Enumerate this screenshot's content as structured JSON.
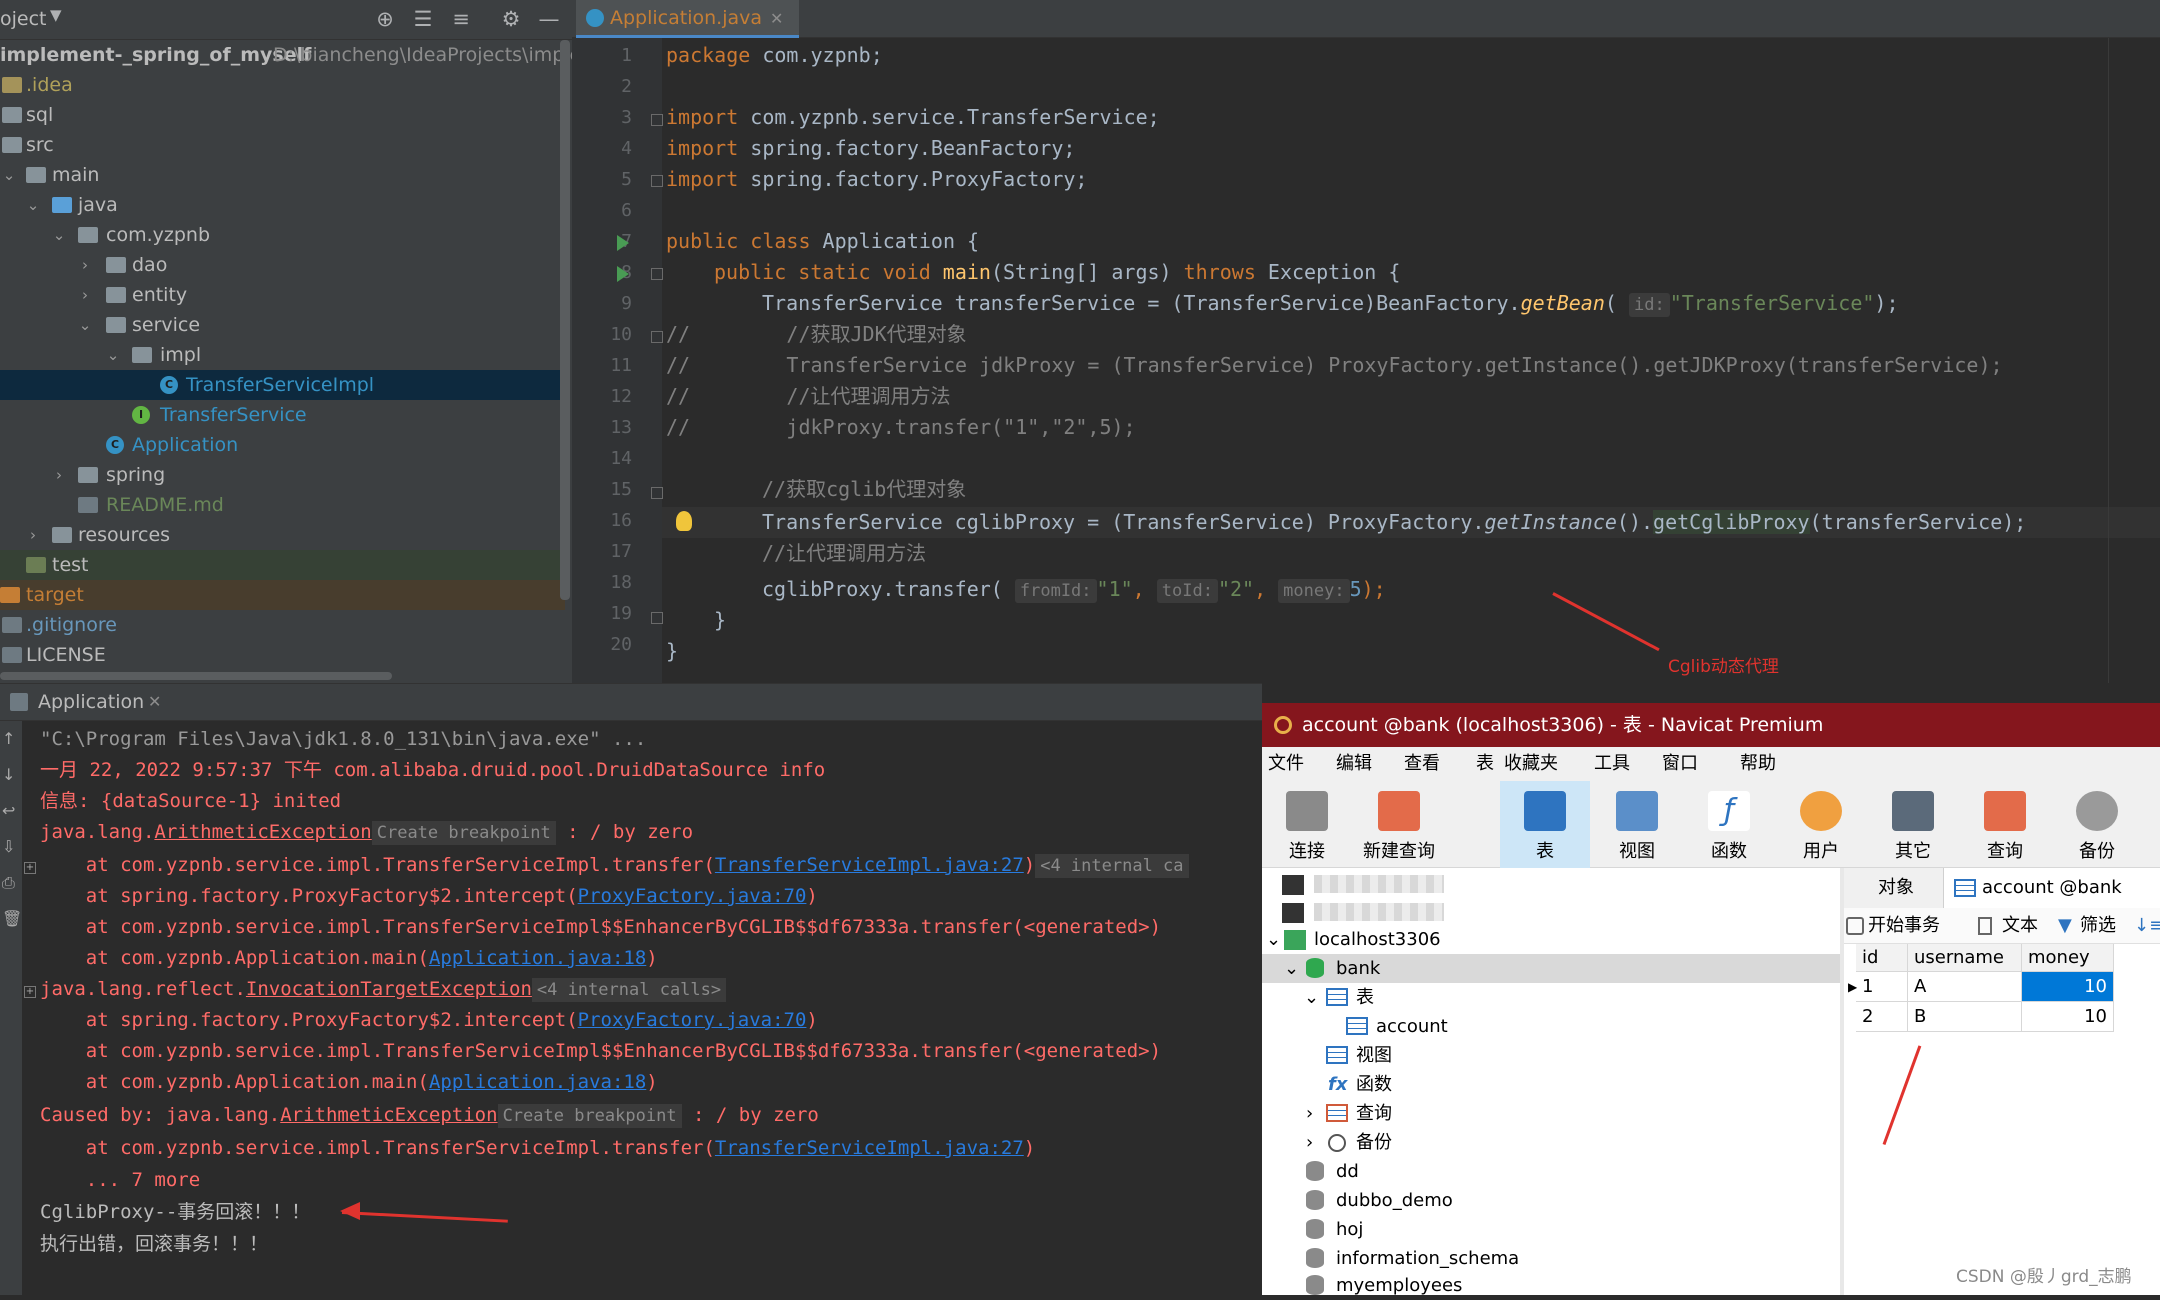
{
  "project": {
    "header_label": "oject",
    "root_name": "implement-_spring_of_myself",
    "root_path": "D:\\biancheng\\IdeaProjects\\implem",
    "items": [
      {
        "label": ".idea"
      },
      {
        "label": "sql"
      },
      {
        "label": "src"
      },
      {
        "label": "main"
      },
      {
        "label": "java"
      },
      {
        "label": "com.yzpnb"
      },
      {
        "label": "dao"
      },
      {
        "label": "entity"
      },
      {
        "label": "service"
      },
      {
        "label": "impl"
      },
      {
        "label": "TransferServiceImpl"
      },
      {
        "label": "TransferService"
      },
      {
        "label": "Application"
      },
      {
        "label": "spring"
      },
      {
        "label": "README.md"
      },
      {
        "label": "resources"
      },
      {
        "label": "test"
      },
      {
        "label": "target"
      },
      {
        "label": ".gitignore"
      },
      {
        "label": "LICENSE"
      }
    ]
  },
  "editor": {
    "tab_label": "Application.java",
    "line_numbers": [
      "1",
      "2",
      "3",
      "4",
      "5",
      "6",
      "7",
      "8",
      "9",
      "10",
      "11",
      "12",
      "13",
      "14",
      "15",
      "16",
      "17",
      "18",
      "19",
      "20"
    ],
    "code": {
      "l1_kw": "package ",
      "l1_rest": "com.yzpnb;",
      "l3_kw": "import ",
      "l3_rest": "com.yzpnb.service.TransferService;",
      "l4_kw": "import ",
      "l4_rest": "spring.factory.BeanFactory;",
      "l5_kw": "import ",
      "l5_rest": "spring.factory.ProxyFactory;",
      "l7_kw": "public class ",
      "l7_rest": "Application {",
      "l8_kw1": "public static void ",
      "l8_fn": "main",
      "l8_mid": "(String[] args) ",
      "l8_kw2": "throws ",
      "l8_rest": "Exception {",
      "l9_a": "TransferService transferService = (TransferService)BeanFactory.",
      "l9_fn": "getBean",
      "l9_b": "( ",
      "l9_hint": "id:",
      "l9_str": "\"TransferService\"",
      "l9_c": ");",
      "l10": "//        //获取JDK代理对象",
      "l11": "//        TransferService jdkProxy = (TransferService) ProxyFactory.getInstance().getJDKProxy(transferService);",
      "l12": "//        //让代理调用方法",
      "l13": "//        jdkProxy.transfer(\"1\",\"2\",5);",
      "l15": "//获取cglib代理对象",
      "l16_a": "TransferService cglibProxy = (TransferService) ProxyFactory.",
      "l16_fn": "getInstance",
      "l16_b": "().",
      "l16_hl": "getCglibProxy",
      "l16_c": "(transferService);",
      "l17": "//让代理调用方法",
      "l18_a": "cglibProxy.transfer( ",
      "l18_h1": "fromId:",
      "l18_s1": "\"1\"",
      "l18_sep1": ", ",
      "l18_h2": "toId:",
      "l18_s2": "\"2\"",
      "l18_sep2": ", ",
      "l18_h3": "money:",
      "l18_n": "5",
      "l18_end": ");",
      "l19": "}",
      "l20": "}"
    },
    "annotation": "Cglib动态代理"
  },
  "run": {
    "tab_label": "Application",
    "lines": {
      "c1": "\"C:\\Program Files\\Java\\jdk1.8.0_131\\bin\\java.exe\" ...",
      "c2": "一月 22, 2022 9:57:37 下午 com.alibaba.druid.pool.DruidDataSource info",
      "c3": "信息: {dataSource-1} inited",
      "c4_a": "java.lang.",
      "c4_link": "ArithmeticException",
      "c4_tag": "Create breakpoint",
      "c4_b": " : / by zero",
      "c5_a": "    at com.yzpnb.service.impl.TransferServiceImpl.transfer(",
      "c5_link": "TransferServiceImpl.java:27",
      "c5_b": ")",
      "c5_tag": "<4 internal ca",
      "c6_a": "    at spring.factory.ProxyFactory$2.intercept(",
      "c6_link": "ProxyFactory.java:70",
      "c6_b": ")",
      "c7": "    at com.yzpnb.service.impl.TransferServiceImpl$$EnhancerByCGLIB$$df67333a.transfer(<generated>)",
      "c8_a": "    at com.yzpnb.Application.main(",
      "c8_link": "Application.java:18",
      "c8_b": ")",
      "c9_a": "java.lang.reflect.",
      "c9_link": "InvocationTargetException",
      "c9_tag": "<4 internal calls>",
      "c10_a": "    at spring.factory.ProxyFactory$2.intercept(",
      "c10_link": "ProxyFactory.java:70",
      "c10_b": ")",
      "c11": "    at com.yzpnb.service.impl.TransferServiceImpl$$EnhancerByCGLIB$$df67333a.transfer(<generated>)",
      "c12_a": "    at com.yzpnb.Application.main(",
      "c12_link": "Application.java:18",
      "c12_b": ")",
      "c13_a": "Caused by: java.lang.",
      "c13_link": "ArithmeticException",
      "c13_tag": "Create breakpoint",
      "c13_b": " : / by zero",
      "c14_a": "    at com.yzpnb.service.impl.TransferServiceImpl.transfer(",
      "c14_link": "TransferServiceImpl.java:27",
      "c14_b": ")",
      "c15": "    ... 7 more",
      "c16": "CglibProxy--事务回滚！！！",
      "c17": "执行出错，回滚事务！！！"
    }
  },
  "navicat": {
    "title": "account @bank (localhost3306) - 表 - Navicat Premium",
    "menu": [
      "文件",
      "编辑",
      "查看",
      "表",
      "收藏夹",
      "工具",
      "窗口",
      "帮助"
    ],
    "toolbar": [
      "连接",
      "新建查询",
      "表",
      "视图",
      "函数",
      "用户",
      "其它",
      "查询",
      "备份"
    ],
    "tree": {
      "host": "localhost3306",
      "db": "bank",
      "tables_node": "表",
      "table": "account",
      "views": "视图",
      "functions": "函数",
      "queries": "查询",
      "backups": "备份",
      "other_dbs": [
        "dd",
        "dubbo_demo",
        "hoj",
        "information_schema",
        "myemployees"
      ]
    },
    "right_tabs": {
      "objects": "对象",
      "table_tab": "account @bank (loca"
    },
    "right_toolbar": {
      "begin_tx": "开始事务",
      "text": "文本",
      "filter": "筛选"
    },
    "grid": {
      "columns": [
        "id",
        "username",
        "money"
      ],
      "rows": [
        [
          "1",
          "A",
          "10"
        ],
        [
          "2",
          "B",
          "10"
        ]
      ]
    }
  },
  "watermark": "CSDN @殷丿grd_志鹏",
  "colors": {
    "annotation_red": "#e0332e",
    "navicat_title": "#85161d",
    "selection_blue": "#0078d7"
  }
}
